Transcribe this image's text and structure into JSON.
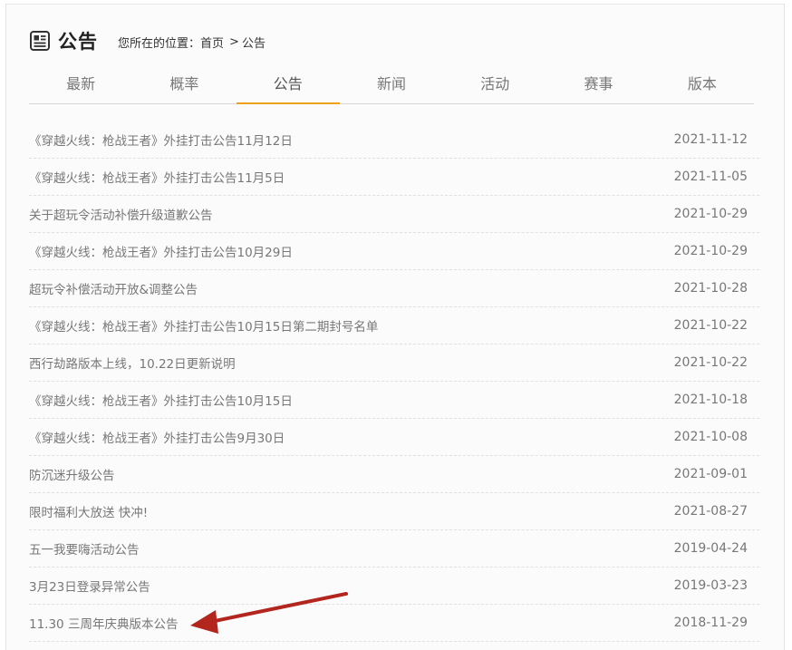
{
  "header": {
    "icon": "document-icon",
    "title": "公告",
    "breadcrumb_label": "您所在的位置：",
    "breadcrumb_home": "首页",
    "breadcrumb_sep": ">",
    "breadcrumb_current": "公告"
  },
  "tabs": [
    {
      "label": "最新"
    },
    {
      "label": "概率"
    },
    {
      "label": "公告"
    },
    {
      "label": "新闻"
    },
    {
      "label": "活动"
    },
    {
      "label": "赛事"
    },
    {
      "label": "版本"
    }
  ],
  "active_tab": "公告",
  "accent_color": "#f0a019",
  "arrow_color": "#b3261e",
  "items": [
    {
      "title": "《穿越火线：枪战王者》外挂打击公告11月12日",
      "date": "2021-11-12"
    },
    {
      "title": "《穿越火线：枪战王者》外挂打击公告11月5日",
      "date": "2021-11-05"
    },
    {
      "title": "关于超玩令活动补偿升级道歉公告",
      "date": "2021-10-29"
    },
    {
      "title": "《穿越火线：枪战王者》外挂打击公告10月29日",
      "date": "2021-10-29"
    },
    {
      "title": "超玩令补偿活动开放&调整公告",
      "date": "2021-10-28"
    },
    {
      "title": "《穿越火线：枪战王者》外挂打击公告10月15日第二期封号名单",
      "date": "2021-10-22"
    },
    {
      "title": "西行劫路版本上线，10.22日更新说明",
      "date": "2021-10-22"
    },
    {
      "title": "《穿越火线：枪战王者》外挂打击公告10月15日",
      "date": "2021-10-18"
    },
    {
      "title": "《穿越火线：枪战王者》外挂打击公告9月30日",
      "date": "2021-10-08"
    },
    {
      "title": "防沉迷升级公告",
      "date": "2021-09-01"
    },
    {
      "title": "限时福利大放送 快冲!",
      "date": "2021-08-27"
    },
    {
      "title": "五一我要嗨活动公告",
      "date": "2019-04-24"
    },
    {
      "title": "3月23日登录异常公告",
      "date": "2019-03-23"
    },
    {
      "title": "11.30 三周年庆典版本公告",
      "date": "2018-11-29"
    }
  ]
}
